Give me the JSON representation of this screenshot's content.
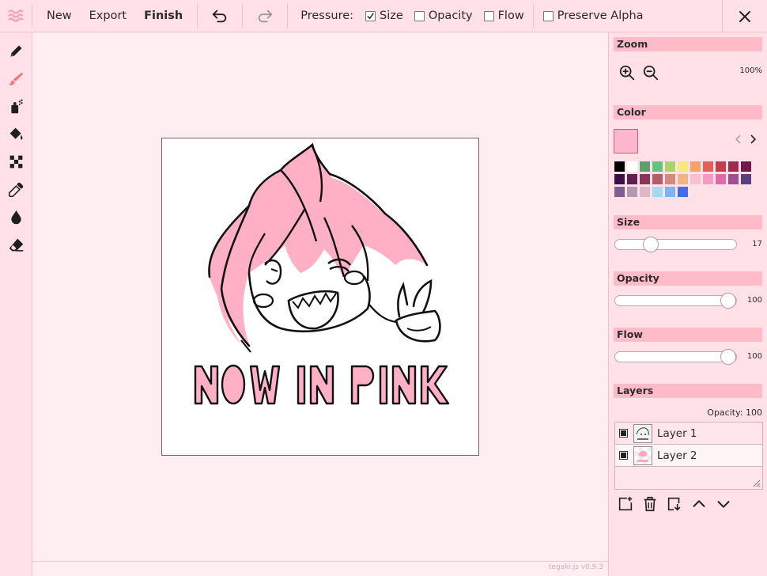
{
  "toolbar": {
    "new_label": "New",
    "export_label": "Export",
    "finish_label": "Finish",
    "pressure_label": "Pressure:",
    "size_label": "Size",
    "opacity_label": "Opacity",
    "flow_label": "Flow",
    "preserve_alpha_label": "Preserve Alpha",
    "size_checked": true,
    "opacity_checked": false,
    "flow_checked": false,
    "preserve_alpha_checked": false
  },
  "tools": [
    "pencil-icon",
    "brush-icon",
    "airbrush-icon",
    "bucket-icon",
    "tone-icon",
    "eyedropper-icon",
    "blur-icon",
    "eraser-icon"
  ],
  "active_tool": "brush-icon",
  "panel": {
    "zoom": {
      "title": "Zoom",
      "value": "100%"
    },
    "color": {
      "title": "Color",
      "current": "#ffb7d0",
      "swatches": [
        "#000000",
        "#ffffff",
        "#5c9f6d",
        "#63c47c",
        "#a9d468",
        "#f5e97a",
        "#f3a36a",
        "#e0605c",
        "#c33f50",
        "#a02a4f",
        "#6f174a",
        "#3c1046",
        "#5f1f52",
        "#8a3555",
        "#b35c6b",
        "#d6887e",
        "#f0b487",
        "#f9c0cf",
        "#f59bc3",
        "#e06aa8",
        "#9e4f91",
        "#5b3f7a",
        "#7c5f8f",
        "#b29bb0",
        "#dcb9c4",
        "#a7d8f3",
        "#7fb4f2",
        "#3f6ee8"
      ]
    },
    "size": {
      "title": "Size",
      "value": "17",
      "fraction": 0.29
    },
    "opacity": {
      "title": "Opacity",
      "value": "100",
      "fraction": 1.0
    },
    "flow": {
      "title": "Flow",
      "value": "100",
      "fraction": 1.0
    },
    "layers": {
      "title": "Layers",
      "opacity_text": "Opacity:  100",
      "items": [
        {
          "name": "Layer 1",
          "visible": true,
          "active": false
        },
        {
          "name": "Layer 2",
          "visible": true,
          "active": true
        }
      ]
    }
  },
  "canvas": {
    "text": "NOW IN PINK"
  },
  "status": {
    "version": "tegaki.js v0.9.3"
  },
  "colors": {
    "accent": "#ffbcc8",
    "toolbar_bg": "#ffe1e7",
    "canvas_bg": "#ffeef1",
    "active_tool": "#ff6f82"
  }
}
